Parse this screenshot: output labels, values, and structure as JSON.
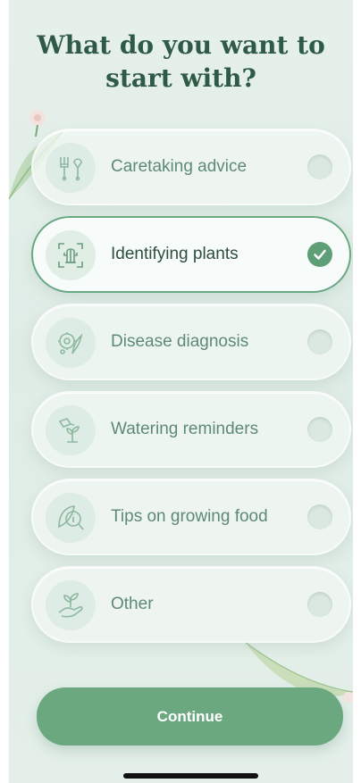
{
  "heading": "What do you want to start with?",
  "options": [
    {
      "label": "Caretaking advice",
      "icon": "tools-icon",
      "selected": false
    },
    {
      "label": "Identifying plants",
      "icon": "scan-plant-icon",
      "selected": true
    },
    {
      "label": "Disease diagnosis",
      "icon": "diagnosis-icon",
      "selected": false
    },
    {
      "label": "Watering reminders",
      "icon": "watering-can-icon",
      "selected": false
    },
    {
      "label": "Tips on growing food",
      "icon": "leaf-info-icon",
      "selected": false
    },
    {
      "label": "Other",
      "icon": "hand-leaf-icon",
      "selected": false
    }
  ],
  "continue_label": "Continue",
  "colors": {
    "accent": "#6ba880",
    "heading": "#2f5a45",
    "selected_border": "#6aa884"
  }
}
